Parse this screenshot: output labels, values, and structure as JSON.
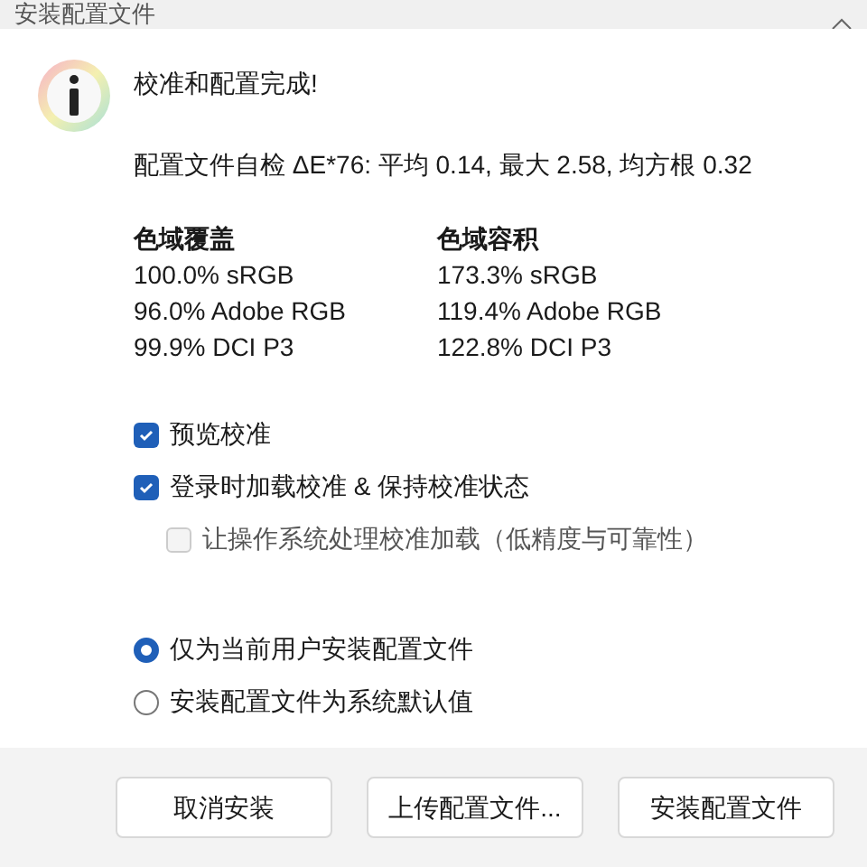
{
  "window": {
    "title": "安装配置文件"
  },
  "heading": "校准和配置完成!",
  "self_check": "配置文件自检 ΔE*76: 平均 0.14, 最大 2.58, 均方根 0.32",
  "gamut_columns": [
    {
      "title": "色域覆盖",
      "rows": [
        "100.0% sRGB",
        "96.0% Adobe RGB",
        "99.9% DCI P3"
      ]
    },
    {
      "title": "色域容积",
      "rows": [
        "173.3% sRGB",
        "119.4% Adobe RGB",
        "122.8% DCI P3"
      ]
    }
  ],
  "options": [
    {
      "kind": "checkbox",
      "label": "预览校准",
      "checked": true,
      "disabled": false,
      "indented": false
    },
    {
      "kind": "checkbox",
      "label": "登录时加载校准 & 保持校准状态",
      "checked": true,
      "disabled": false,
      "indented": false
    },
    {
      "kind": "checkbox",
      "label": "让操作系统处理校准加载（低精度与可靠性）",
      "checked": false,
      "disabled": true,
      "indented": true
    }
  ],
  "scope": [
    {
      "label": "仅为当前用户安装配置文件",
      "selected": true
    },
    {
      "label": "安装配置文件为系统默认值",
      "selected": false
    }
  ],
  "buttons": [
    "取消安装",
    "上传配置文件...",
    "安装配置文件"
  ]
}
